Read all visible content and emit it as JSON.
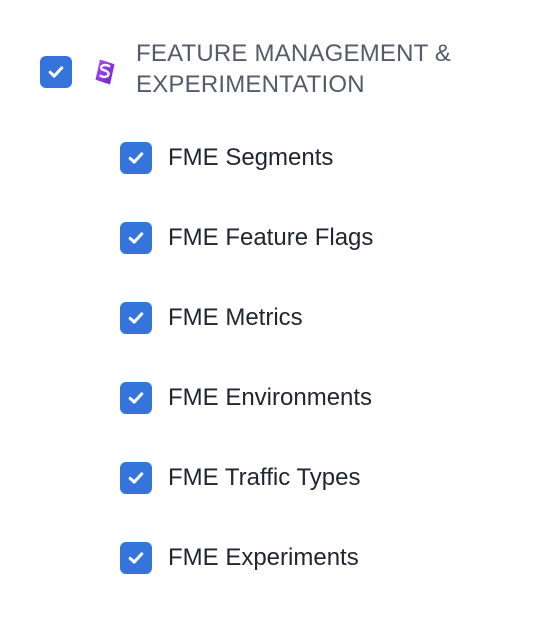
{
  "parent": {
    "checked": true,
    "icon": "split-s-icon",
    "title": "FEATURE MANAGEMENT & EXPERIMENTATION"
  },
  "children": [
    {
      "label": "FME Segments",
      "checked": true
    },
    {
      "label": "FME Feature Flags",
      "checked": true
    },
    {
      "label": "FME Metrics",
      "checked": true
    },
    {
      "label": "FME Environments",
      "checked": true
    },
    {
      "label": "FME Traffic Types",
      "checked": true
    },
    {
      "label": "FME Experiments",
      "checked": true
    }
  ],
  "colors": {
    "checkbox": "#3474db",
    "checkmark": "#ffffff",
    "parent_text": "#545b69",
    "child_text": "#222631",
    "icon_purple": "#8f32d8"
  }
}
